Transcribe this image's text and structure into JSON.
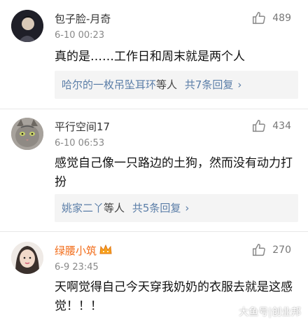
{
  "comments": [
    {
      "username": "包子脸-月奇",
      "time": "6-10 00:23",
      "likes": "489",
      "text": "真的是……工作日和周末就是两个人",
      "reply_names": "哈尔的一枚吊坠耳环",
      "reply_mid": "等人",
      "reply_count": "共7条回复",
      "avatar_icon": "dark-portrait-avatar"
    },
    {
      "username": "平行空间17",
      "time": "6-10 06:53",
      "likes": "434",
      "text": "感觉自己像一只路边的土狗，然而没有动力打扮",
      "reply_names": "姚家二丫",
      "reply_mid": "等人",
      "reply_count": "共5条回复",
      "avatar_icon": "cat-avatar"
    },
    {
      "username": "绿腰小筑",
      "time": "6-9 23:45",
      "likes": "270",
      "text": "天啊觉得自己今天穿我奶奶的衣服去就是这感觉！！！",
      "avatar_icon": "girl-portrait-avatar"
    }
  ],
  "watermark": "大鱼号|创业邦",
  "colors": {
    "link": "#5b7ea8",
    "vip_name": "#f26d1a"
  }
}
